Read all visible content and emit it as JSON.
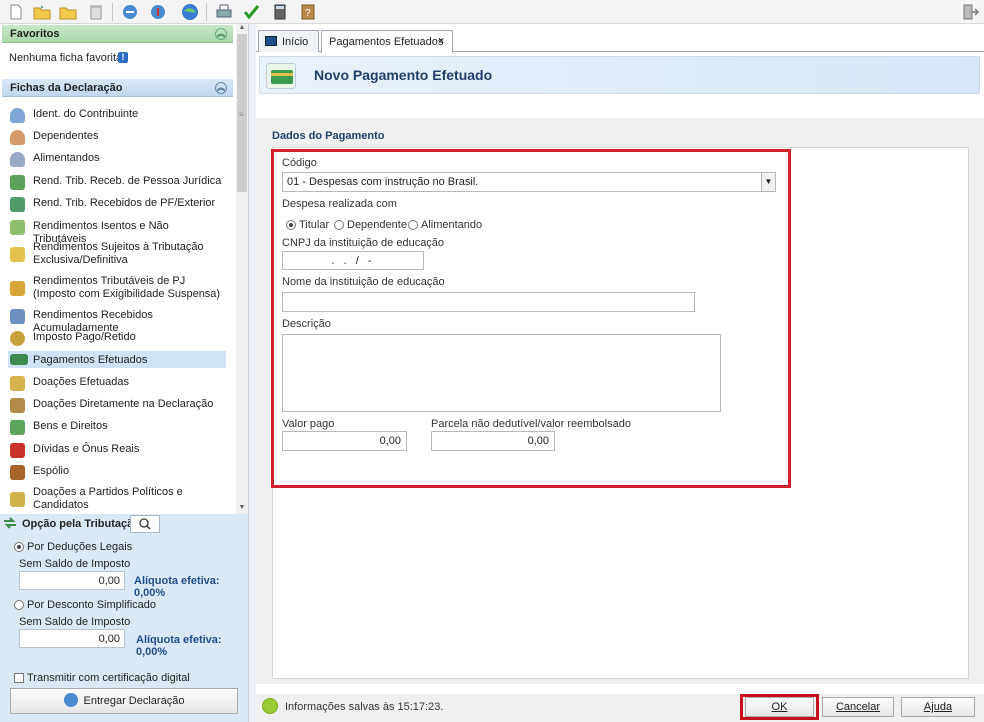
{
  "toolbar": {
    "icons": [
      "new-doc-icon",
      "open-folder-icon",
      "folder-icon",
      "trash-icon",
      "import-icon",
      "export-icon",
      "globe-icon",
      "print-icon",
      "check-icon",
      "calculator-icon",
      "help-book-icon",
      "exit-icon"
    ]
  },
  "favorites": {
    "title": "Favoritos",
    "empty_text": "Nenhuma ficha favorita"
  },
  "fichas": {
    "title": "Fichas da Declaração",
    "items": [
      {
        "label": "Ident. do Contribuinte",
        "icon": "person-icon",
        "color": "#7fa6d6"
      },
      {
        "label": "Dependentes",
        "icon": "dependents-icon",
        "color": "#d69a6a"
      },
      {
        "label": "Alimentandos",
        "icon": "people-icon",
        "color": "#9aa9c6"
      },
      {
        "label": "Rend. Trib. Receb. de Pessoa Jurídica",
        "icon": "money-in-icon",
        "color": "#5ba05b"
      },
      {
        "label": "Rend. Trib. Recebidos de PF/Exterior",
        "icon": "money-globe-icon",
        "color": "#4e9a6a"
      },
      {
        "label": "Rendimentos Isentos e Não Tributáveis",
        "icon": "exempt-icon",
        "color": "#8ec06b"
      },
      {
        "label": "Rendimentos Sujeitos à Tributação Exclusiva/Definitiva",
        "icon": "warning-doc-icon",
        "color": "#e2c14a"
      },
      {
        "label": "Rendimentos Tributáveis de PJ (Imposto com Exigibilidade Suspensa)",
        "icon": "suspended-icon",
        "color": "#d9a53a"
      },
      {
        "label": "Rendimentos Recebidos Acumuladamente",
        "icon": "accumulated-icon",
        "color": "#6c8fc0"
      },
      {
        "label": "Imposto Pago/Retido",
        "icon": "tax-paid-icon",
        "color": "#c9a13c"
      },
      {
        "label": "Pagamentos Efetuados",
        "icon": "card-icon",
        "color": "#3e8a4e"
      },
      {
        "label": "Doações Efetuadas",
        "icon": "donation-icon",
        "color": "#d8b24a"
      },
      {
        "label": "Doações Diretamente na Declaração",
        "icon": "donation-direct-icon",
        "color": "#b48a4a"
      },
      {
        "label": "Bens e Direitos",
        "icon": "assets-icon",
        "color": "#5aa55a"
      },
      {
        "label": "Dívidas e Ônus Reais",
        "icon": "debt-arrow-icon",
        "color": "#c8302a"
      },
      {
        "label": "Espólio",
        "icon": "chest-icon",
        "color": "#a8652a"
      },
      {
        "label": "Doações a Partidos Políticos e Candidatos",
        "icon": "political-icon",
        "color": "#d0b24a"
      }
    ],
    "selected_index": 10
  },
  "tributacao": {
    "title": "Opção pela Tributação:",
    "deducoes_label": "Por Deduções Legais",
    "deducoes_sub": "Sem Saldo de Imposto",
    "deducoes_value": "0,00",
    "deducoes_aliquota": "Alíquota efetiva: 0,00%",
    "simplificado_label": "Por Desconto Simplificado",
    "simplificado_sub": "Sem Saldo de Imposto",
    "simplificado_value": "0,00",
    "simplificado_aliquota": "Alíquota efetiva: 0,00%",
    "transmitir_label": "Transmitir com certificação digital",
    "entregar_label": "Entregar Declaração"
  },
  "tabs": [
    {
      "label": "Início"
    },
    {
      "label": "Pagamentos Efetuados",
      "close": "×"
    }
  ],
  "banner": {
    "title": "Novo Pagamento Efetuado"
  },
  "form": {
    "section_title": "Dados do Pagamento",
    "codigo_label": "Código",
    "codigo_value": "01 - Despesas com instrução no Brasil.",
    "despesa_label": "Despesa realizada com",
    "radio_titular": "Titular",
    "radio_dependente": "Dependente",
    "radio_alimentando": "Alimentando",
    "cnpj_label": "CNPJ da instituição de educação",
    "cnpj_mask": ". . / -",
    "nome_label": "Nome da instituição de educação",
    "nome_value": "",
    "descricao_label": "Descrição",
    "descricao_value": "",
    "valor_label": "Valor pago",
    "valor_value": "0,00",
    "parcela_label": "Parcela não dedutível/valor reembolsado",
    "parcela_value": "0,00"
  },
  "status": {
    "text": "Informações salvas às 15:17:23.",
    "ok_label": "OK",
    "cancel_label": "Cancelar",
    "help_label": "Ajuda"
  },
  "colors": {
    "highlight_red": "#d0202a",
    "banner_title": "#1f3f6a",
    "selected_bg": "#cfe3f5"
  }
}
